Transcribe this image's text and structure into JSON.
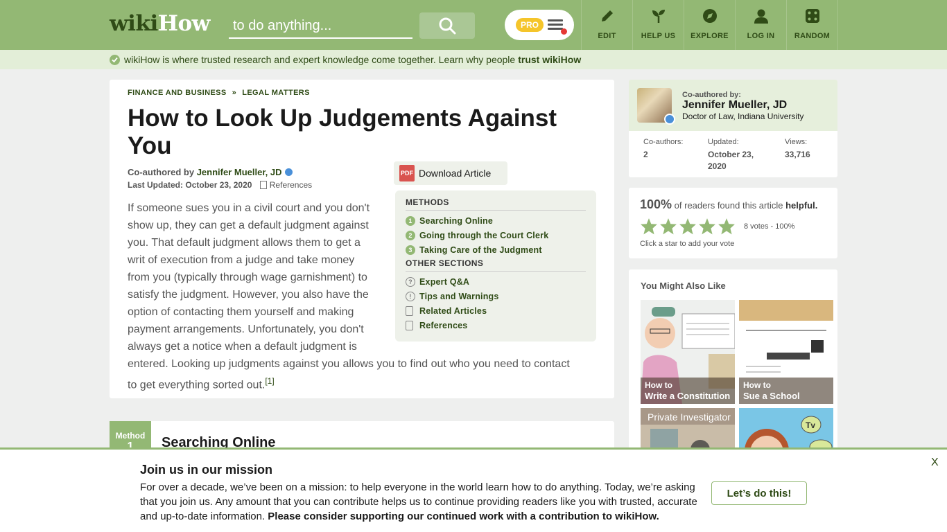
{
  "header": {
    "logo_wiki": "wiki",
    "logo_how": "How",
    "search_placeholder": "to do anything...",
    "pro_label": "PRO",
    "nav": [
      {
        "label": "EDIT",
        "icon": "pencil-icon"
      },
      {
        "label": "HELP US",
        "icon": "sprout-icon"
      },
      {
        "label": "EXPLORE",
        "icon": "compass-icon"
      },
      {
        "label": "LOG IN",
        "icon": "user-icon"
      },
      {
        "label": "RANDOM",
        "icon": "dice-icon"
      }
    ]
  },
  "trustbar": {
    "text": "wikiHow is where trusted research and expert knowledge come together. Learn why people",
    "link": "trust wikiHow"
  },
  "article": {
    "breadcrumb": [
      "FINANCE AND BUSINESS",
      "»",
      "LEGAL MATTERS"
    ],
    "title": "How to Look Up Judgements Against You",
    "coauthored_prefix": "Co-authored by",
    "author": "Jennifer Mueller, JD",
    "last_updated_label": "Last Updated:",
    "last_updated": "October 23, 2020",
    "references_label": "References",
    "download_label": "Download Article",
    "pdf_label": "PDF",
    "intro": "If someone sues you in a civil court and you don't show up, they can get a default judgment against you. That default judgment allows them to get a writ of execution from a judge and take money from you (typically through wage garnishment) to satisfy the judgment. However, you also have the option of contacting them yourself and making payment arrangements. Unfortunately, you don't always get a notice when a default judgment is entered. Looking up judgments against you allows you to find out who you need to contact to get everything sorted out.",
    "intro_ref": "[1]"
  },
  "toc": {
    "methods_heading": "METHODS",
    "methods": [
      {
        "num": "1",
        "label": "Searching Online"
      },
      {
        "num": "2",
        "label": "Going through the Court Clerk"
      },
      {
        "num": "3",
        "label": "Taking Care of the Judgment"
      }
    ],
    "other_heading": "OTHER SECTIONS",
    "other": [
      {
        "icon": "?",
        "label": "Expert Q&A"
      },
      {
        "icon": "!",
        "label": "Tips and Warnings"
      },
      {
        "icon": "",
        "label": "Related Articles"
      },
      {
        "icon": "",
        "label": "References"
      }
    ]
  },
  "method": {
    "tab_label": "Method",
    "tab_num": "1",
    "title": "Searching Online"
  },
  "sidebar": {
    "coauth_label": "Co-authored by:",
    "author_name": "Jennifer Mueller, JD",
    "author_cred": "Doctor of Law, Indiana University",
    "stats": [
      {
        "label": "Co-authors:",
        "value": "2"
      },
      {
        "label": "Updated:",
        "value": "October 23, 2020"
      },
      {
        "label": "Views:",
        "value": "33,716"
      }
    ],
    "helpful_pct": "100%",
    "helpful_text": "of readers found this article",
    "helpful_bold": "helpful.",
    "votes": "8 votes - 100%",
    "add_vote": "Click a star to add your vote",
    "stars_rating": 5,
    "also_title": "You Might Also Like",
    "also": [
      {
        "howto": "How to",
        "title": "Write a Constitution"
      },
      {
        "howto": "How to",
        "title": "Sue a School"
      },
      {
        "label": "Private Investigator"
      },
      {
        "label": ""
      }
    ]
  },
  "banner": {
    "title": "Join us in our mission",
    "text": "For over a decade, we’ve been on a mission: to help everyone in the world learn how to do anything. Today, we’re asking that you join us. Any amount that you can contribute helps us to continue providing readers like you with trusted, accurate and up-to-date information.",
    "bold": "Please consider supporting our continued work with a contribution to wikiHow.",
    "cta": "Let’s do this!",
    "close": "X"
  },
  "colors": {
    "brand_green": "#93b874",
    "dark_green": "#2f4b16",
    "pro_yellow": "#f5c52b"
  }
}
